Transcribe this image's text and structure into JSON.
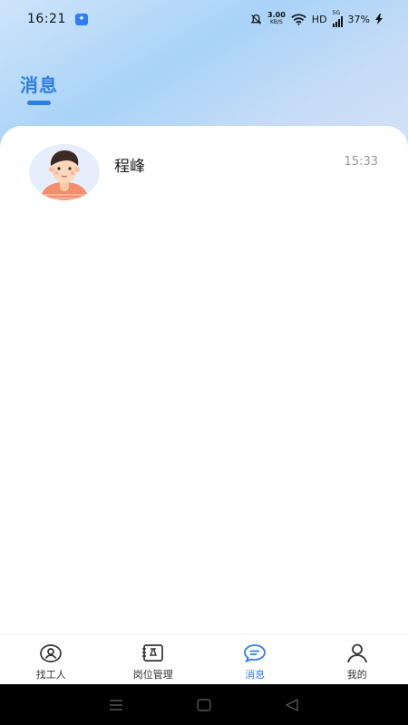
{
  "status_bar": {
    "time": "16:21",
    "net_speed_value": "3.00",
    "net_speed_unit": "KB/S",
    "hd": "HD",
    "network_type": "5G",
    "battery": "37%"
  },
  "header": {
    "title": "消息"
  },
  "conversations": [
    {
      "name": "程峰",
      "time": "15:33"
    }
  ],
  "bottom_nav": [
    {
      "label": "找工人",
      "icon": "find-worker-icon",
      "active": false
    },
    {
      "label": "岗位管理",
      "icon": "job-management-icon",
      "active": false
    },
    {
      "label": "消息",
      "icon": "message-icon",
      "active": true
    },
    {
      "label": "我的",
      "icon": "profile-icon",
      "active": false
    }
  ],
  "colors": {
    "accent": "#2f7ee0",
    "header_gradient_start": "#cfe4fb",
    "header_gradient_mid": "#a9d3f7"
  }
}
